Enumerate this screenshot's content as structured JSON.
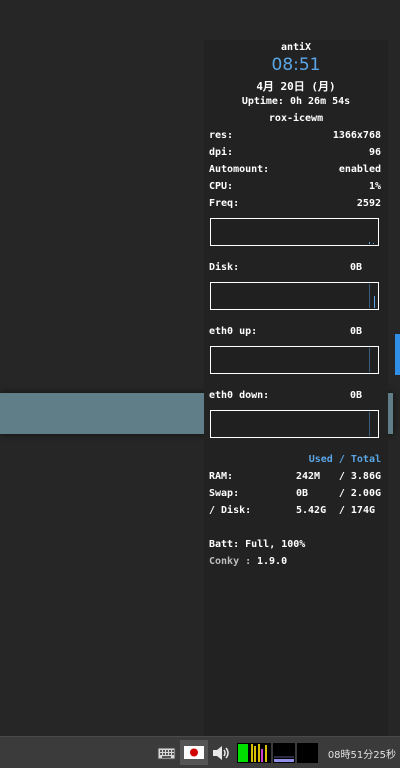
{
  "conky": {
    "distro": "antiX",
    "time": "08:51",
    "date": "4月 20日 (月)",
    "uptime": "Uptime: 0h 26m 54s",
    "wm": "rox-icewm",
    "stats": [
      {
        "label": "res:",
        "value": "1366x768"
      },
      {
        "label": "dpi:",
        "value": "96"
      },
      {
        "label": "Automount:",
        "value": "enabled"
      },
      {
        "label": "CPU:",
        "value": "1%"
      },
      {
        "label": "Freq:",
        "value": "2592"
      }
    ],
    "disk_label": "Disk:",
    "disk_value": "0B",
    "eth_up_label": "eth0 up:",
    "eth_up_value": "0B",
    "eth_down_label": "eth0 down:",
    "eth_down_value": "0B",
    "used_total_header": "Used / Total",
    "mem": [
      {
        "label": "RAM:",
        "used": "242M",
        "total": "/ 3.86G"
      },
      {
        "label": "Swap:",
        "used": "0B",
        "total": "/ 2.00G"
      },
      {
        "label": "/ Disk:",
        "used": "5.42G",
        "total": "/ 174G"
      }
    ],
    "battery": "Batt: Full, 100%",
    "conky_version_label": "Conky :",
    "conky_version": "1.9.0",
    "accent_color": "#5aa6e6"
  },
  "taskbar": {
    "clock": "08時51分25秒",
    "icons": [
      "keyboard-icon",
      "japan-flag-icon",
      "volume-icon",
      "cpu-monitor-icon",
      "network-monitor-icon",
      "memory-monitor-icon"
    ]
  }
}
